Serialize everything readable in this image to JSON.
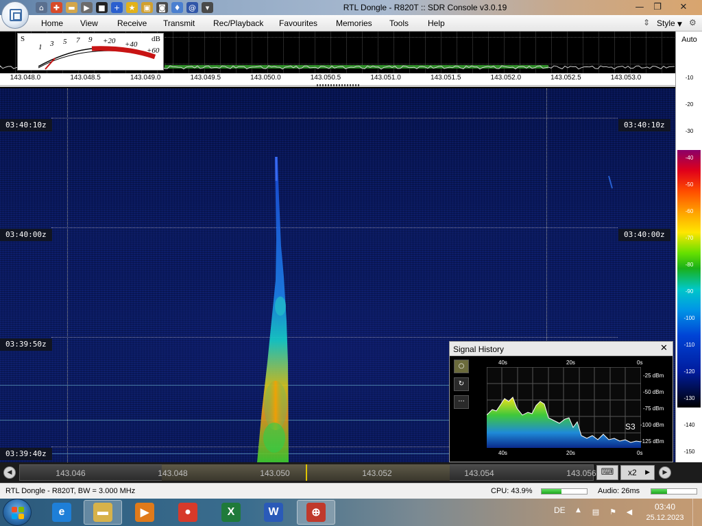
{
  "window": {
    "title": "RTL Dongle - R820T :: SDR Console v3.0.19",
    "minimize_glyph": "—",
    "maximize_glyph": "❐",
    "close_glyph": "✕"
  },
  "quick_access_icons": [
    {
      "name": "home-icon",
      "glyph": "⌂",
      "color": "#5a6f8e"
    },
    {
      "name": "lifebuoy-icon",
      "glyph": "✚",
      "color": "#d84b2a"
    },
    {
      "name": "folder-icon",
      "glyph": "▬",
      "color": "#d3a64a"
    },
    {
      "name": "play-icon",
      "glyph": "▶",
      "color": "#6c6c6c"
    },
    {
      "name": "stop-icon",
      "glyph": "■",
      "color": "#222222"
    },
    {
      "name": "add-icon",
      "glyph": "+",
      "color": "#2a5fcf"
    },
    {
      "name": "star-icon",
      "glyph": "★",
      "color": "#e2b21a"
    },
    {
      "name": "lock-icon",
      "glyph": "▣",
      "color": "#d0a030"
    },
    {
      "name": "camera-icon",
      "glyph": "◙",
      "color": "#4a4a4a"
    },
    {
      "name": "drop-icon",
      "glyph": "♦",
      "color": "#4a7fd0"
    },
    {
      "name": "swirl-icon",
      "glyph": "@",
      "color": "#3056a8"
    },
    {
      "name": "dropdown-icon",
      "glyph": "▾",
      "color": "#4a4a4a"
    }
  ],
  "menu": {
    "items": [
      "Home",
      "View",
      "Receive",
      "Transmit",
      "Rec/Playback",
      "Favourites",
      "Memories",
      "Tools",
      "Help"
    ],
    "style_label": "Style"
  },
  "smeter": {
    "s_label": "S",
    "db_label": "dB",
    "scale": [
      "1",
      "3",
      "5",
      "7",
      "9",
      "+20",
      "+40",
      "+60"
    ],
    "level_s": 1
  },
  "freq_ruler": [
    "143.048.0",
    "143.048.5",
    "143.049.0",
    "143.049.5",
    "143.050.0",
    "143.050.5",
    "143.051.0",
    "143.051.5",
    "143.052.0",
    "143.052.5",
    "143.053.0"
  ],
  "dbscale": {
    "auto_label": "Auto",
    "ticks": [
      "-10",
      "-20",
      "-30",
      "-40",
      "-50",
      "-60",
      "-70",
      "-80",
      "-90",
      "-100",
      "-110",
      "-120",
      "-130",
      "-140",
      "-150"
    ]
  },
  "waterfall": {
    "timestamps": [
      "03:40:10z",
      "03:40:00z",
      "03:39:50z",
      "03:39:40z"
    ]
  },
  "bottom_scale": [
    "143.046",
    "143.048",
    "143.050",
    "143.052",
    "143.054",
    "143.056"
  ],
  "bottombar": {
    "prev_glyph": "◀",
    "next_glyph": "▶",
    "keyboard_glyph": "⌨",
    "zoom_label": "x2",
    "zoom_arrow": "▶"
  },
  "signal_history": {
    "title": "Signal History",
    "close_glyph": "✕",
    "tools": [
      "○",
      "↻",
      "···"
    ],
    "time_labels": [
      "40s",
      "20s",
      "0s"
    ],
    "dbm_labels": [
      "-25 dBm",
      "-50 dBm",
      "-75 dBm",
      "-100 dBm",
      "-125 dBm"
    ],
    "s_reading": "S3"
  },
  "status": {
    "left": "RTL Dongle - R820T, BW = 3.000 MHz",
    "cpu": "CPU: 43.9%",
    "cpu_level": 0.439,
    "audio": "Audio: 26ms",
    "audio_level": 0.35
  },
  "taskbar": {
    "apps": [
      {
        "name": "internet-explorer-icon",
        "label": "e",
        "color": "#1e7fd8",
        "active": false
      },
      {
        "name": "file-explorer-icon",
        "label": "▬",
        "color": "#d7b24a",
        "active": true
      },
      {
        "name": "media-player-icon",
        "label": "▶",
        "color": "#e07a1a",
        "active": false
      },
      {
        "name": "chrome-icon",
        "label": "●",
        "color": "#d73a2a",
        "active": false
      },
      {
        "name": "excel-icon",
        "label": "X",
        "color": "#1f7a3a",
        "active": false
      },
      {
        "name": "word-icon",
        "label": "W",
        "color": "#2a5ab8",
        "active": false
      },
      {
        "name": "sdr-console-icon",
        "label": "⊕",
        "color": "#c0392b",
        "active": true
      }
    ],
    "language": "DE",
    "tray_up": "▲",
    "time": "03:40",
    "date": "25.12.2023"
  }
}
